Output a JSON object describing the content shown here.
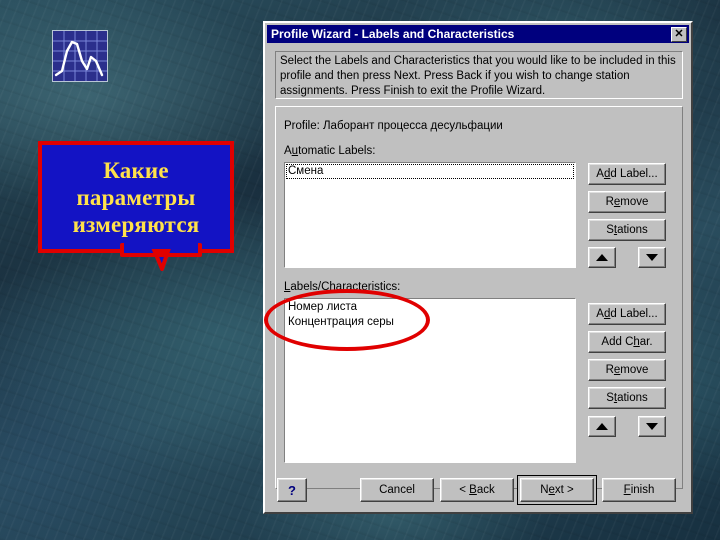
{
  "background": {
    "texture_name": "marble-teal-background",
    "base_color": "#24414f"
  },
  "chart_icon": {
    "name": "line-chart-icon",
    "background_color": "#2b2f8c",
    "line_color": "#ffffff"
  },
  "callout": {
    "lines": [
      "Какие",
      "параметры",
      "измеряются"
    ],
    "full_text": "Какие параметры измеряются",
    "fill_color": "#1313c4",
    "border_color": "#e00000",
    "text_color": "#ffe24a"
  },
  "annotation_ellipse": {
    "name": "red-ellipse-highlight",
    "color": "#e00000",
    "targets": "Labels/Characteristics list"
  },
  "dialog": {
    "title": "Profile Wizard - Labels and Characteristics",
    "titlebar_color": "#00007e",
    "close_label": "✕",
    "instruction": "Select the Labels and Characteristics that you would like to be included in this profile and then press Next.  Press Back if you wish to change station assignments.  Press Finish to exit the Profile Wizard.",
    "profile_label": "Profile:",
    "profile_value": "Лаборант процесса десульфации",
    "automatic_labels": {
      "caption_prefix": "A",
      "caption_mnemonic": "u",
      "caption_suffix": "tomatic Labels:",
      "caption_full": "Automatic Labels:",
      "items": [
        "Смена"
      ],
      "focused_index": 0,
      "buttons": [
        {
          "label_prefix": "A",
          "mnemonic": "d",
          "label_suffix": "d Label...",
          "label_full": "Add Label..."
        },
        {
          "label_prefix": "R",
          "mnemonic": "e",
          "label_suffix": "move",
          "label_full": "Remove"
        },
        {
          "label_prefix": "S",
          "mnemonic": "t",
          "label_suffix": "ations",
          "label_full": "Stations"
        }
      ],
      "move_up": "move-up",
      "move_down": "move-down"
    },
    "labels_characteristics": {
      "caption_prefix": "",
      "caption_mnemonic": "L",
      "caption_suffix": "abels/Characteristics:",
      "caption_full": "Labels/Characteristics:",
      "items": [
        "Номер листа",
        "Концентрация серы"
      ],
      "buttons": [
        {
          "label_prefix": "A",
          "mnemonic": "d",
          "label_suffix": "d Label...",
          "label_full": "Add Label..."
        },
        {
          "label_prefix": "Add C",
          "mnemonic": "h",
          "label_suffix": "ar.",
          "label_full": "Add Char."
        },
        {
          "label_prefix": "R",
          "mnemonic": "e",
          "label_suffix": "move",
          "label_full": "Remove"
        },
        {
          "label_prefix": "S",
          "mnemonic": "t",
          "label_suffix": "ations",
          "label_full": "Stations"
        }
      ],
      "move_up": "move-up",
      "move_down": "move-down"
    },
    "footer": {
      "help": "?",
      "cancel": "Cancel",
      "back_prefix": "< ",
      "back_mnemonic": "B",
      "back_suffix": "ack",
      "back_full": "< Back",
      "next_prefix": "N",
      "next_mnemonic": "e",
      "next_suffix": "xt >",
      "next_full": "Next >",
      "finish_prefix": "",
      "finish_mnemonic": "F",
      "finish_suffix": "inish",
      "finish_full": "Finish",
      "default_button": "Next >"
    }
  }
}
